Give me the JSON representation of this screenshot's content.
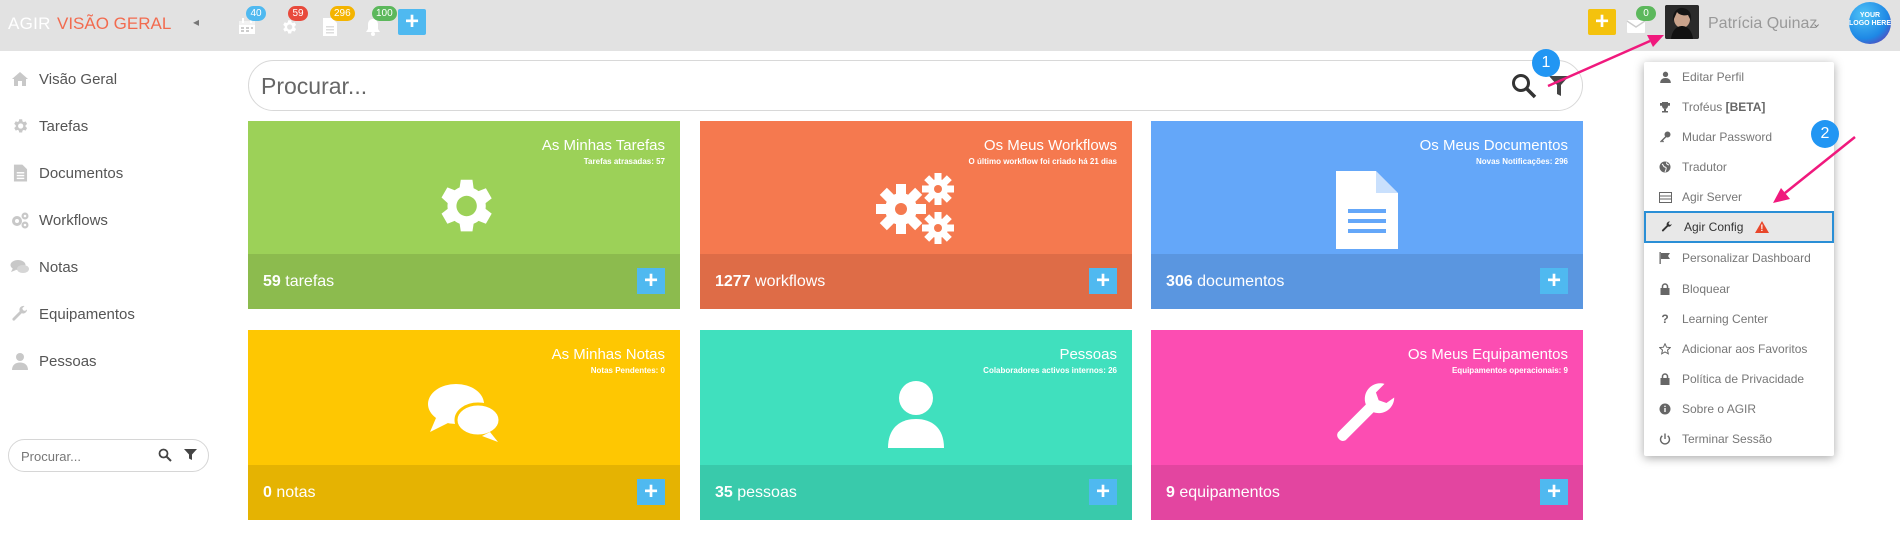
{
  "topbar": {
    "brand": "AGIR",
    "page_title": "VISÃO GERAL",
    "collapse_glyph": "◂",
    "notifications": [
      {
        "icon": "calendar-icon",
        "count": "40",
        "color": "#4fb9f0"
      },
      {
        "icon": "gear-icon",
        "count": "59",
        "color": "#e84a3c"
      },
      {
        "icon": "document-icon",
        "count": "296",
        "color": "#f4b400"
      },
      {
        "icon": "bell-icon",
        "count": "100",
        "color": "#5cb85c"
      }
    ],
    "add_glyph": "+",
    "quick_add_glyph": "+",
    "inbox_count": "0",
    "user_name": "Patrícia Quinaz",
    "user_caret": "⌄",
    "logo_text": "YOUR LOGO HERE"
  },
  "sidebar": {
    "items": [
      {
        "label": "Visão Geral",
        "icon": "home-icon"
      },
      {
        "label": "Tarefas",
        "icon": "gear-icon"
      },
      {
        "label": "Documentos",
        "icon": "document-icon"
      },
      {
        "label": "Workflows",
        "icon": "gears-icon"
      },
      {
        "label": "Notas",
        "icon": "comments-icon"
      },
      {
        "label": "Equipamentos",
        "icon": "wrench-icon"
      },
      {
        "label": "Pessoas",
        "icon": "user-icon"
      }
    ],
    "search_placeholder": "Procurar..."
  },
  "main_search": {
    "placeholder": "Procurar..."
  },
  "tiles": [
    {
      "title": "As Minhas Tarefas",
      "subtitle": "Tarefas atrasadas: 57",
      "count": "59",
      "unit": "tarefas",
      "icon": "gear-icon",
      "color": "#9cd158",
      "footer_color": "#8cbb4e"
    },
    {
      "title": "Os Meus Workflows",
      "subtitle": "O último workflow foi criado há 21 dias",
      "count": "1277",
      "unit": "workflows",
      "icon": "gears-icon",
      "color": "#f5794f",
      "footer_color": "#de6c47"
    },
    {
      "title": "Os Meus Documentos",
      "subtitle": "Novas Notificações: 296",
      "count": "306",
      "unit": "documentos",
      "icon": "document-icon",
      "color": "#64a7f9",
      "footer_color": "#5a96e0"
    },
    {
      "title": "As Minhas Notas",
      "subtitle": "Notas Pendentes: 0",
      "count": "0",
      "unit": "notas",
      "icon": "comments-icon",
      "color": "#fec702",
      "footer_color": "#e5b302"
    },
    {
      "title": "Pessoas",
      "subtitle": "Colaboradores activos internos: 26",
      "count": "35",
      "unit": "pessoas",
      "icon": "user-icon",
      "color": "#40e0be",
      "footer_color": "#39caab"
    },
    {
      "title": "Os Meus Equipamentos",
      "subtitle": "Equipamentos operacionais: 9",
      "count": "9",
      "unit": "equipamentos",
      "icon": "wrench-icon",
      "color": "#fc4db2",
      "footer_color": "#e345a0"
    }
  ],
  "tile_add_glyph": "+",
  "dropdown": {
    "items": [
      {
        "label": "Editar Perfil",
        "icon": "user-icon"
      },
      {
        "label": "Troféus",
        "badge": "[BETA]",
        "icon": "trophy-icon"
      },
      {
        "label": "Mudar Password",
        "icon": "key-icon"
      },
      {
        "label": "Tradutor",
        "icon": "globe-icon"
      },
      {
        "label": "Agir Server",
        "icon": "server-icon"
      },
      {
        "label": "Agir Config",
        "icon": "wrench-icon",
        "warning": "!"
      },
      {
        "label": "Personalizar Dashboard",
        "icon": "flag-icon"
      },
      {
        "label": "Bloquear",
        "icon": "lock-icon"
      },
      {
        "label": "Learning Center",
        "icon": "question-icon"
      },
      {
        "label": "Adicionar aos Favoritos",
        "icon": "star-icon"
      },
      {
        "label": "Política de Privacidade",
        "icon": "lock-icon"
      },
      {
        "label": "Sobre o AGIR",
        "icon": "info-icon"
      },
      {
        "label": "Terminar Sessão",
        "icon": "power-icon"
      }
    ]
  },
  "annotations": {
    "step1": "1",
    "step2": "2",
    "arrow_color": "#f0197d"
  }
}
